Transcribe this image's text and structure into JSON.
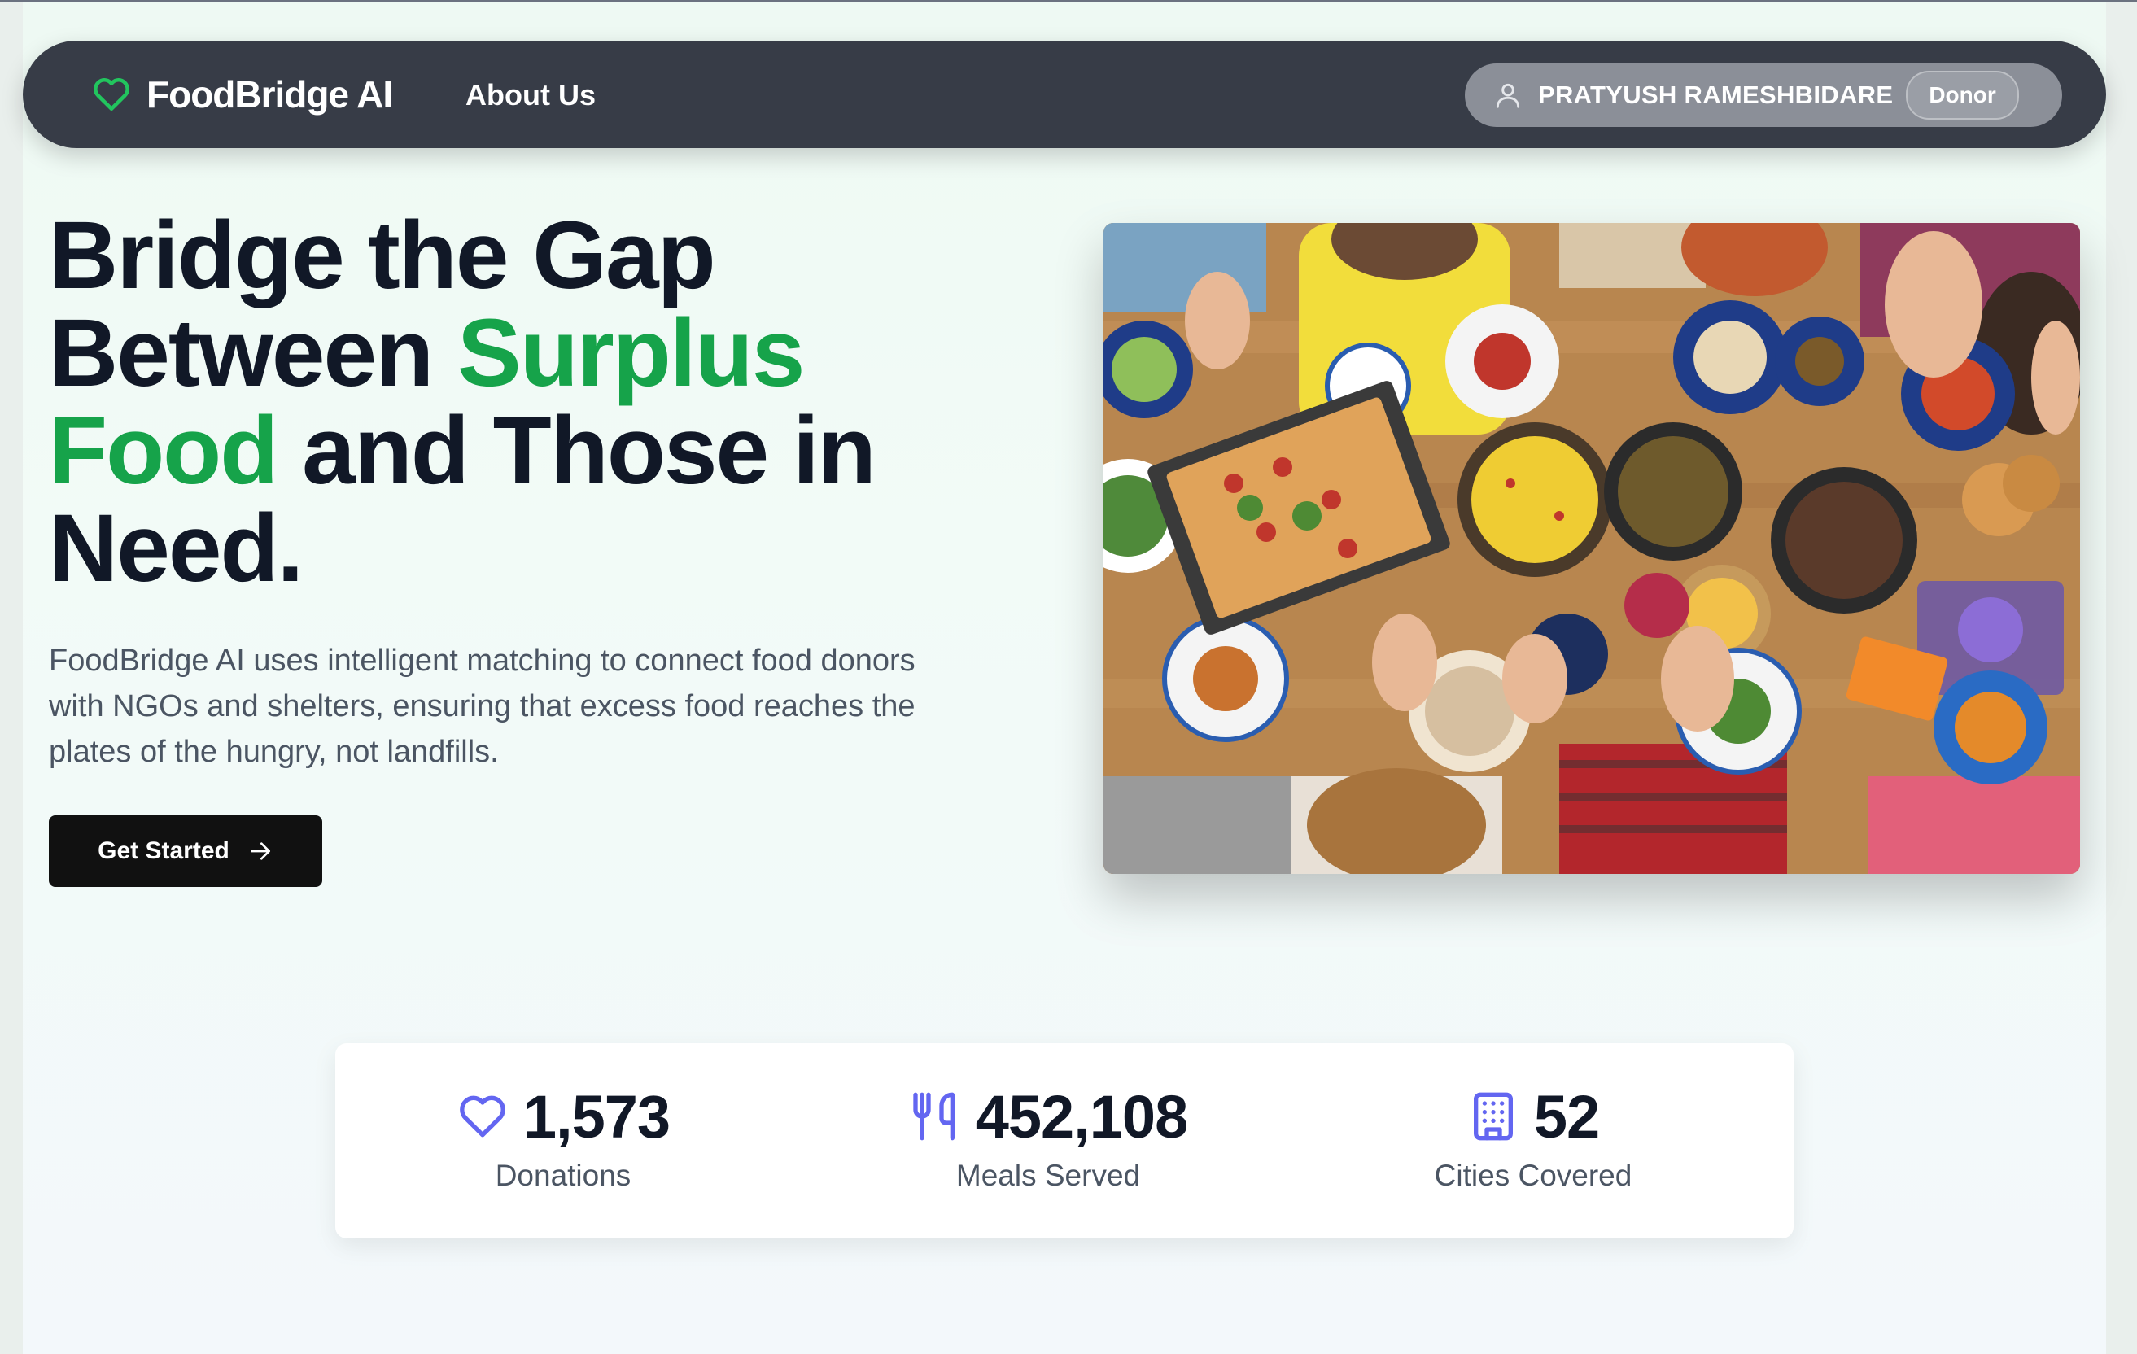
{
  "nav": {
    "brand": "FoodBridge AI",
    "links": [
      "About Us"
    ],
    "user": {
      "name": "PRATYUSH RAMESHBIDARE",
      "role": "Donor"
    }
  },
  "hero": {
    "headline": {
      "line1": "Bridge the Gap",
      "line2_prefix": "Between ",
      "highlight1": "Surplus",
      "highlight2": "Food",
      "line3_suffix": " and Those in",
      "line4": "Need."
    },
    "description": "FoodBridge AI uses intelligent matching to connect food donors with NGOs and shelters, ensuring that excess food reaches the plates of the hungry, not landfills.",
    "cta_label": "Get Started"
  },
  "stats": [
    {
      "icon": "heart-icon",
      "value": "1,573",
      "label": "Donations"
    },
    {
      "icon": "utensils-icon",
      "value": "452,108",
      "label": "Meals Served"
    },
    {
      "icon": "building-icon",
      "value": "52",
      "label": "Cities Covered"
    }
  ],
  "colors": {
    "brand_green": "#16a34a",
    "nav_bg": "#373c47",
    "stat_icon": "#6366f1",
    "cta_bg": "#111111"
  }
}
